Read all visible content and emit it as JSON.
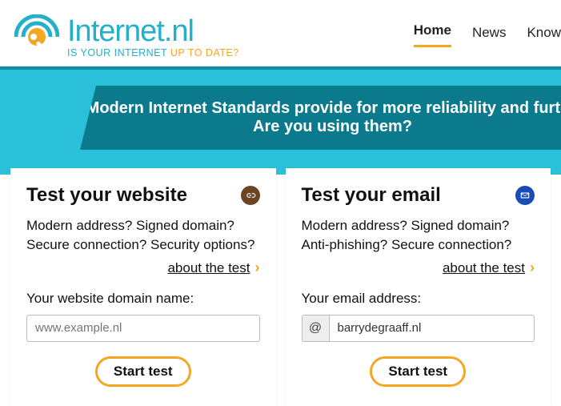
{
  "header": {
    "logo_title": "Internet.nl",
    "logo_sub_a": "IS YOUR INTERNET",
    "logo_sub_b": " UP TO DATE?",
    "nav": [
      {
        "label": "Home",
        "active": true
      },
      {
        "label": "News",
        "active": false
      },
      {
        "label": "Know",
        "active": false
      }
    ]
  },
  "hero": {
    "line1": "Modern Internet Standards provide for more reliability and furthe",
    "line2": "Are you using them?"
  },
  "cards": {
    "website": {
      "title": "Test your website",
      "desc": "Modern address? Signed domain? Secure connection? Security options?",
      "about": "about the test",
      "field_label": "Your website domain name:",
      "placeholder": "www.example.nl",
      "value": "",
      "button": "Start test"
    },
    "email": {
      "title": "Test your email",
      "desc": "Modern address? Signed domain? Anti-phishing? Secure connection?",
      "about": "about the test",
      "field_label": "Your email address:",
      "at": "@",
      "value": "barrydegraaff.nl",
      "button": "Start test"
    }
  }
}
